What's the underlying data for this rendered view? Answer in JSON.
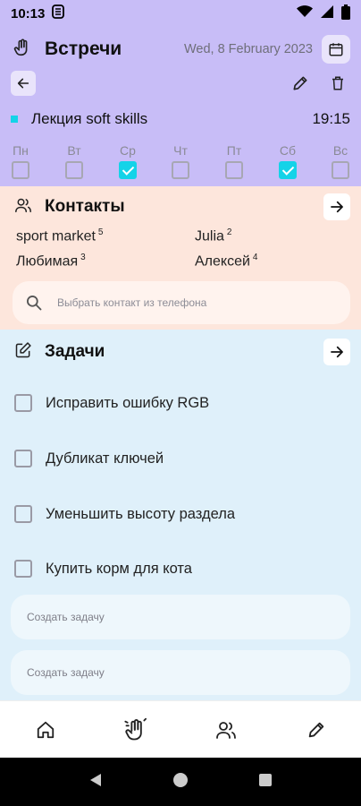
{
  "status_bar": {
    "time": "10:13"
  },
  "header": {
    "title": "Встречи",
    "date": "Wed, 8 February 2023",
    "event": {
      "name": "Лекция soft skills",
      "time": "19:15",
      "color": "#14d3e8"
    },
    "days": [
      {
        "label": "Пн",
        "checked": false
      },
      {
        "label": "Вт",
        "checked": false
      },
      {
        "label": "Ср",
        "checked": true
      },
      {
        "label": "Чт",
        "checked": false
      },
      {
        "label": "Пт",
        "checked": false
      },
      {
        "label": "Сб",
        "checked": true
      },
      {
        "label": "Вс",
        "checked": false
      }
    ]
  },
  "contacts": {
    "title": "Контакты",
    "items": [
      {
        "name": "sport market",
        "count": "5"
      },
      {
        "name": "Julia",
        "count": "2"
      },
      {
        "name": "Любимая",
        "count": "3"
      },
      {
        "name": "Алексей",
        "count": "4"
      }
    ],
    "search_placeholder": "Выбрать контакт из телефона"
  },
  "tasks": {
    "title": "Задачи",
    "items": [
      {
        "label": "Исправить ошибку RGB",
        "checked": false
      },
      {
        "label": "Дубликат ключей",
        "checked": false
      },
      {
        "label": "Уменьшить высоту раздела",
        "checked": false
      },
      {
        "label": "Купить корм для кота",
        "checked": false
      }
    ],
    "create_placeholders": [
      "Создать задачу",
      "Создать задачу"
    ]
  },
  "colors": {
    "header_bg": "#c8bdf7",
    "contacts_bg": "#fde6dc",
    "tasks_bg": "#dff0fa",
    "accent": "#14d3e8"
  },
  "bottom_nav": [
    "home-icon",
    "meetings-icon",
    "contacts-icon",
    "edit-icon"
  ]
}
